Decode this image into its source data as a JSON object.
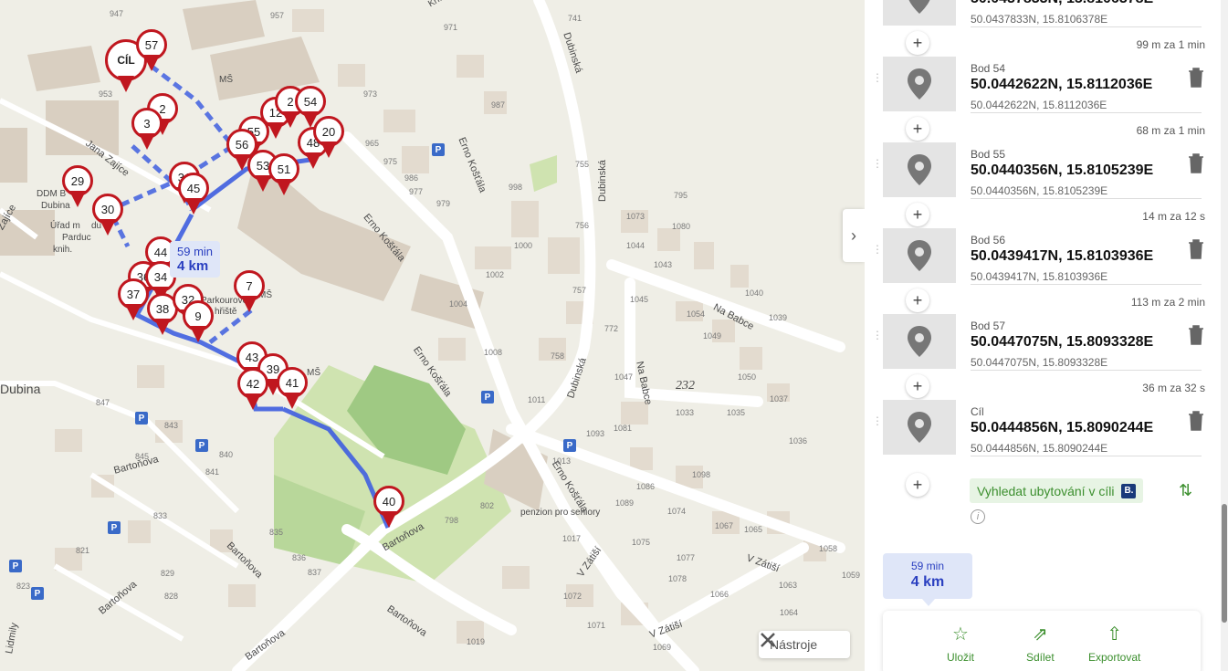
{
  "map": {
    "route_time": "59 min",
    "route_distance": "4 km",
    "tools_label": "Nástroje",
    "collapse_icon": "chevron-right-icon",
    "street_labels": [
      "Dubinská",
      "Dubinská",
      "Dubinská",
      "Erno Košťála",
      "Erno Košťála",
      "Erno Košťála",
      "Erno Košťála",
      "Na Babce",
      "Na Babce",
      "Bartoňova",
      "Bartoňova",
      "Bartoňova",
      "Bartoňova",
      "Bartoňova",
      "Bartoňova",
      "Jana Zajíce",
      "Zajíce",
      "V Zátiší",
      "V Zátiší",
      "V Zátiší",
      "Dubina",
      "penzion pro seniory",
      "Lidmily",
      "MŠ",
      "MŠ",
      "MŠ",
      "232",
      "DDM B",
      "Dubina",
      "Úřad m",
      "du",
      "Parduc",
      "knih.",
      "Parkourové",
      "hřiště",
      "Kříb"
    ],
    "house_numbers": [
      "947",
      "957",
      "971",
      "973",
      "987",
      "965",
      "975",
      "977",
      "979",
      "986",
      "998",
      "741",
      "755",
      "756",
      "1073",
      "1080",
      "795",
      "1044",
      "1043",
      "1040",
      "1045",
      "1054",
      "1039",
      "1049",
      "1050",
      "1047",
      "1033",
      "1035",
      "1037",
      "1036",
      "1002",
      "1004",
      "1008",
      "1011",
      "1000",
      "757",
      "758",
      "772",
      "1093",
      "1081",
      "1089",
      "1086",
      "1098",
      "1074",
      "1067",
      "1065",
      "1058",
      "1059",
      "1063",
      "1066",
      "1075",
      "1077",
      "1078",
      "1072",
      "1071",
      "1069",
      "1019",
      "1017",
      "1013",
      "798",
      "802",
      "847",
      "843",
      "845",
      "840",
      "841",
      "833",
      "835",
      "836",
      "837",
      "821",
      "823",
      "829",
      "828",
      "953",
      "1064"
    ],
    "markers": [
      "CÍL",
      "57",
      "2",
      "3",
      "12",
      "2",
      "54",
      "55",
      "56",
      "48",
      "20",
      "53",
      "51",
      "31",
      "45",
      "29",
      "30",
      "44",
      "36",
      "34",
      "37",
      "38",
      "32",
      "9",
      "7",
      "43",
      "39",
      "42",
      "41",
      "40"
    ],
    "parking_icon_label": "P"
  },
  "sidebar": {
    "waypoints": [
      {
        "name": "",
        "coord": "50.0437833N, 15.8106378E",
        "coord_small": "50.0437833N, 15.8106378E"
      },
      {
        "name": "Bod 54",
        "coord": "50.0442622N, 15.8112036E",
        "coord_small": "50.0442622N, 15.8112036E"
      },
      {
        "name": "Bod 55",
        "coord": "50.0440356N, 15.8105239E",
        "coord_small": "50.0440356N, 15.8105239E"
      },
      {
        "name": "Bod 56",
        "coord": "50.0439417N, 15.8103936E",
        "coord_small": "50.0439417N, 15.8103936E"
      },
      {
        "name": "Bod 57",
        "coord": "50.0447075N, 15.8093328E",
        "coord_small": "50.0447075N, 15.8093328E"
      },
      {
        "name": "Cíl",
        "coord": "50.0444856N, 15.8090244E",
        "coord_small": "50.0444856N, 15.8090244E"
      }
    ],
    "segments": [
      "99 m za 1 min",
      "68 m za 1 min",
      "14 m za 12 s",
      "113 m za 2 min",
      "36 m za 32 s"
    ],
    "booking_label": "Vyhledat ubytování v cíli",
    "booking_badge": "B.",
    "summary": {
      "time": "59 min",
      "distance": "4 km"
    },
    "actions": {
      "save": "Uložit",
      "share": "Sdílet",
      "export": "Exportovat"
    },
    "colors": {
      "accent_green": "#3c8f2e",
      "route_blue": "#3f5fe0",
      "marker_red": "#c0171f"
    }
  }
}
